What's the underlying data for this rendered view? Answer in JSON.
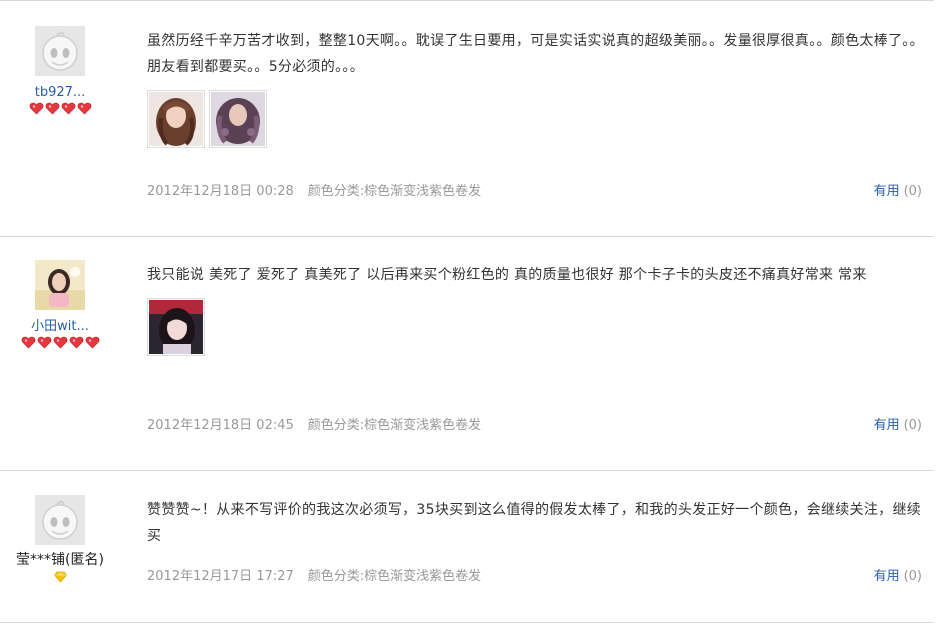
{
  "reviews": [
    {
      "user": {
        "name": "tb927...",
        "avatar": "default-avatar",
        "rank": 4,
        "rank_icon": "red-heart"
      },
      "text": "虽然历经千辛万苦才收到，整整10天啊。。耽误了生日要用，可是实话实说真的超级美丽。。发量很厚很真。。颜色太棒了。。朋友看到都要买。。5分必须的。。。",
      "photos": [
        "wavy-brown-hair-photo",
        "purple-curly-wig-photo"
      ],
      "date": "2012年12月18日 00:28",
      "spec": "颜色分类:棕色渐变浅紫色卷发",
      "useful_label": "有用",
      "useful_count": "(0)"
    },
    {
      "user": {
        "name": "小田wit...",
        "avatar": "user-photo-avatar",
        "rank": 5,
        "rank_icon": "red-heart"
      },
      "text": "我只能说 美死了 爱死了 真美死了 以后再来买个粉红色的 真的质量也很好 那个卡子卡的头皮还不痛真好常来 常来",
      "photos": [
        "selfie-photo"
      ],
      "date": "2012年12月18日 02:45",
      "spec": "颜色分类:棕色渐变浅紫色卷发",
      "useful_label": "有用",
      "useful_count": "(0)"
    },
    {
      "user": {
        "name": "莹***铺(匿名)",
        "avatar": "default-avatar",
        "rank": 1,
        "rank_icon": "yellow-diamond"
      },
      "text": "赞赞赞~！从来不写评价的我这次必须写，35块买到这么值得的假发太棒了，和我的头发正好一个颜色，会继续关注，继续买",
      "photos": [],
      "date": "2012年12月17日 17:27",
      "spec": "颜色分类:棕色渐变浅紫色卷发",
      "useful_label": "有用",
      "useful_count": "(0)"
    }
  ],
  "colors": {
    "link": "#2a5da8",
    "meta": "#999999",
    "border": "#d9d9d9",
    "heart": "#e8383d",
    "diamond": "#f5c400"
  }
}
